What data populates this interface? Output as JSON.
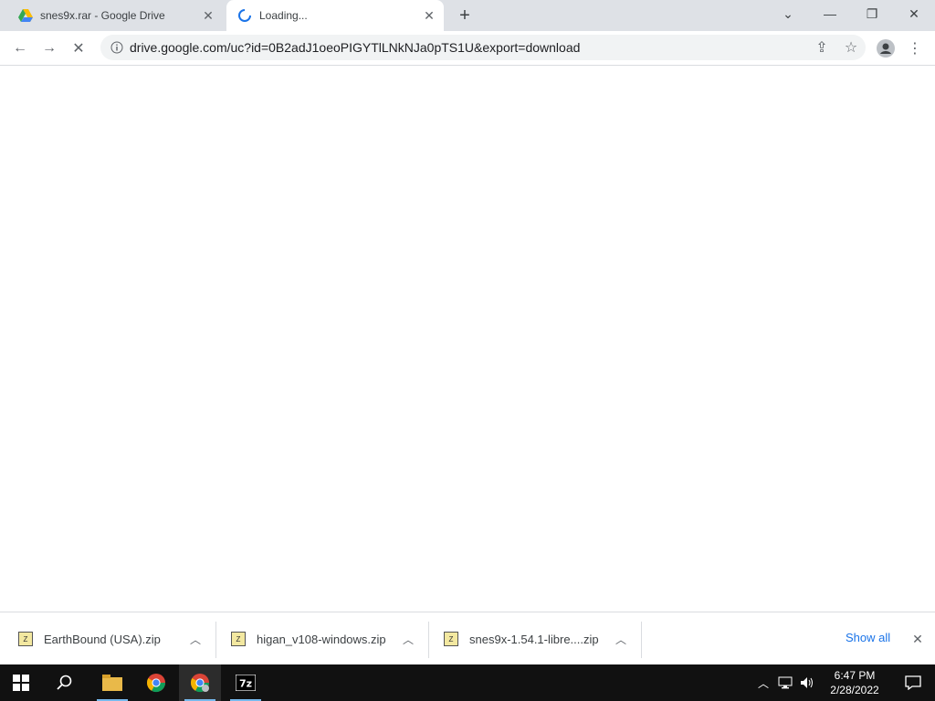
{
  "tabs": [
    {
      "title": "snes9x.rar - Google Drive",
      "favicon": "google-drive-icon"
    },
    {
      "title": "Loading...",
      "favicon": "loading-spinner-icon"
    }
  ],
  "toolbar": {
    "url": "drive.google.com/uc?id=0B2adJ1oeoPIGYTlLNkNJa0pTS1U&export=download"
  },
  "downloads": [
    {
      "name": "EarthBound (USA).zip"
    },
    {
      "name": "higan_v108-windows.zip"
    },
    {
      "name": "snes9x-1.54.1-libre....zip"
    }
  ],
  "shelf": {
    "show_all": "Show all"
  },
  "clock": {
    "time": "6:47 PM",
    "date": "2/28/2022"
  },
  "colors": {
    "accent": "#1a73e8",
    "tabstrip": "#dee1e6",
    "taskbar": "#111111"
  }
}
